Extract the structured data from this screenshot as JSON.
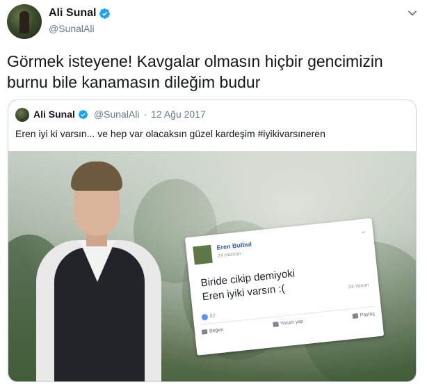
{
  "tweet": {
    "author": {
      "name": "Ali Sunal",
      "handle": "@SunalAli",
      "verified": true
    },
    "text": "Görmek isteyene! Kavgalar olmasın hiçbir gencimizin burnu bile kanamasın dileğim budur",
    "quoted": {
      "name": "Ali Sunal",
      "handle": "@SunalAli",
      "separator": "·",
      "date": "12 Ağu 2017",
      "text": "Eren iyi ki varsın... ve hep var olacaksın güzel kardeşim #iyikivarsıneren",
      "photo": {
        "overlay_post": {
          "name": "Eren Bulbul",
          "date": "24 Haziran · ",
          "post_line_1": "Biride cikip demiyoki",
          "post_line_2": "Eren iyiki varsın :(",
          "comments": "24 Yorum",
          "likes": "82",
          "actions": [
            "Beğen",
            "Yorum yap",
            "Paylaş"
          ]
        }
      }
    }
  },
  "colors": {
    "verified_blue": "#1da1f2",
    "secondary_text": "#657786",
    "border": "#ccd6dd"
  },
  "icons": {
    "verified": "verified-badge-icon",
    "menu": "chevron-down-icon"
  }
}
